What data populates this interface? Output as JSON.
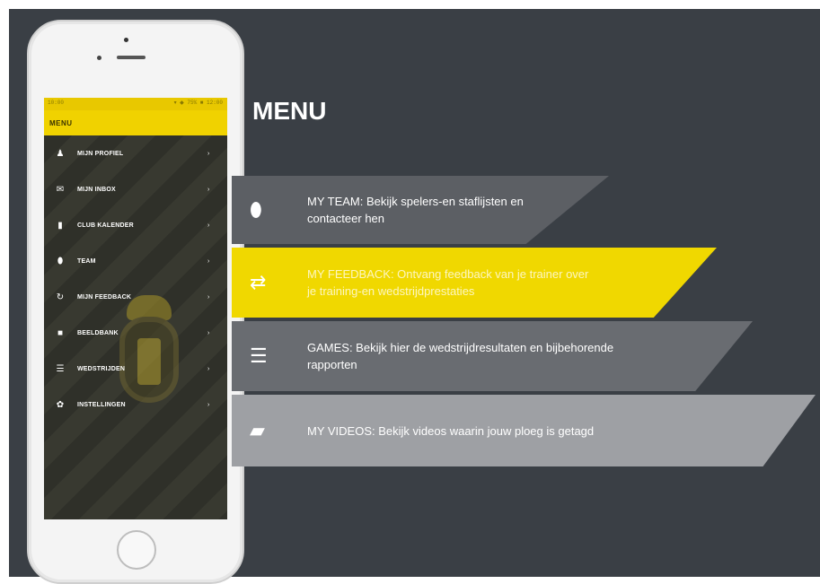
{
  "phone": {
    "status_left": "10:00",
    "status_right": "▾ ◆ 75% ■ 12:00",
    "appbar_title": "MENU",
    "menu": [
      {
        "icon": "user-icon",
        "glyph": "♟",
        "label": "MIJN PROFIEL"
      },
      {
        "icon": "mail-icon",
        "glyph": "✉",
        "label": "MIJN INBOX"
      },
      {
        "icon": "calendar-icon",
        "glyph": "▮",
        "label": "CLUB KALENDER"
      },
      {
        "icon": "shield-icon",
        "glyph": "⬮",
        "label": "TEAM"
      },
      {
        "icon": "refresh-icon",
        "glyph": "↻",
        "label": "MIJN FEEDBACK"
      },
      {
        "icon": "video-icon",
        "glyph": "■",
        "label": "BEELDBANK"
      },
      {
        "icon": "list-icon",
        "glyph": "☰",
        "label": "WEDSTRIJDEN"
      },
      {
        "icon": "gear-icon",
        "glyph": "✿",
        "label": "INSTELLINGEN"
      }
    ],
    "arrow": "›"
  },
  "panel": {
    "title": "MENU",
    "items": [
      {
        "icon": "shield-icon",
        "glyph": "⬮",
        "line1": "MY TEAM: Bekijk spelers-en staflijsten en",
        "line2": "contacteer hen",
        "color": "#5c5f64"
      },
      {
        "icon": "swap-icon",
        "glyph": "⇄",
        "line1": "MY FEEDBACK: Ontvang feedback van je trainer over",
        "line2": "je training-en wedstrijdprestaties",
        "color": "#f0d800"
      },
      {
        "icon": "list-icon",
        "glyph": "☰",
        "line1": "GAMES: Bekijk hier de wedstrijdresultaten  en bijbehorende",
        "line2": "rapporten",
        "color": "#696c71"
      },
      {
        "icon": "camera-icon",
        "glyph": "▰",
        "line1": "MY VIDEOS: Bekijk videos waarin jouw ploeg is getagd",
        "line2": "",
        "color": "#9ea0a4"
      }
    ]
  },
  "colors": {
    "background": "#3a3f45",
    "accent": "#f0d800",
    "drawer": "#2f3029"
  }
}
